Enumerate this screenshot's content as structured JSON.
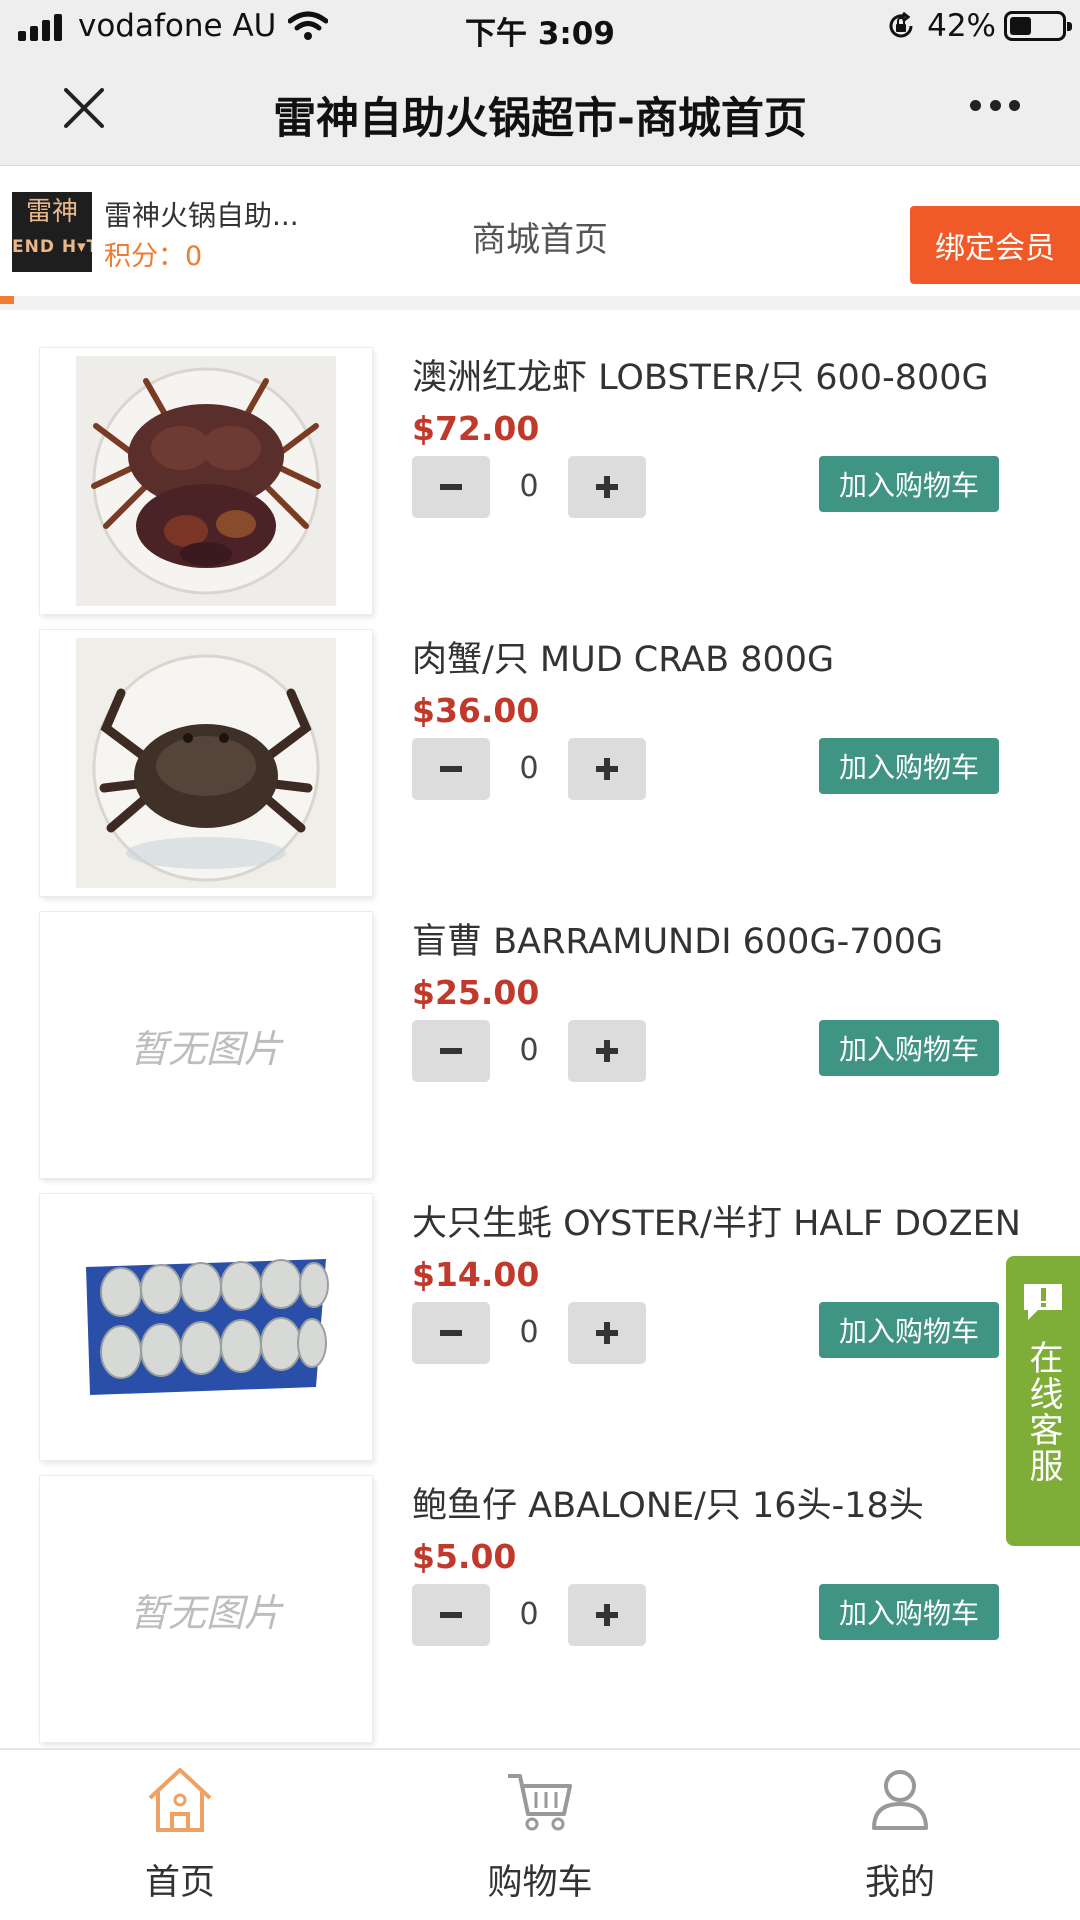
{
  "status_bar": {
    "carrier": "vodafone AU",
    "time": "下午 3:09",
    "battery": "42%",
    "battery_level": 0.42
  },
  "title_bar": {
    "title": "雷神自助火锅超市-商城首页"
  },
  "shop": {
    "logo_top": "雷神",
    "logo_bottom": "END H▾T",
    "name": "雷神火锅自助...",
    "points": "积分：0",
    "page_name": "商城首页",
    "bind_button": "绑定会员"
  },
  "products": [
    {
      "name": "澳洲红龙虾 LOBSTER/只 600-800G",
      "price": "$72.00",
      "qty": "0",
      "add_label": "加入购物车",
      "image": "lobster"
    },
    {
      "name": "肉蟹/只 MUD CRAB 800G",
      "price": "$36.00",
      "qty": "0",
      "add_label": "加入购物车",
      "image": "crab"
    },
    {
      "name": "盲曹 BARRAMUNDI 600G-700G",
      "price": "$25.00",
      "qty": "0",
      "add_label": "加入购物车",
      "image": "none",
      "no_image_text": "暂无图片"
    },
    {
      "name": "大只生蚝 OYSTER/半打 HALF DOZEN",
      "price": "$14.00",
      "qty": "0",
      "add_label": "加入购物车",
      "image": "oysters"
    },
    {
      "name": "鲍鱼仔 ABALONE/只 16头-18头",
      "price": "$5.00",
      "qty": "0",
      "add_label": "加入购物车",
      "image": "none",
      "no_image_text": "暂无图片"
    }
  ],
  "service_tab": {
    "label": "在线客服",
    "icon": "chat-bubble-icon"
  },
  "bottom_nav": [
    {
      "label": "首页",
      "icon": "home-icon",
      "active": true
    },
    {
      "label": "购物车",
      "icon": "cart-icon",
      "active": false
    },
    {
      "label": "我的",
      "icon": "user-icon",
      "active": false
    }
  ],
  "colors": {
    "accent_orange": "#f07b32",
    "bind_button": "#f05a28",
    "add_to_cart": "#3f9484",
    "price": "#c0392b",
    "service_tab": "#7fae38"
  }
}
